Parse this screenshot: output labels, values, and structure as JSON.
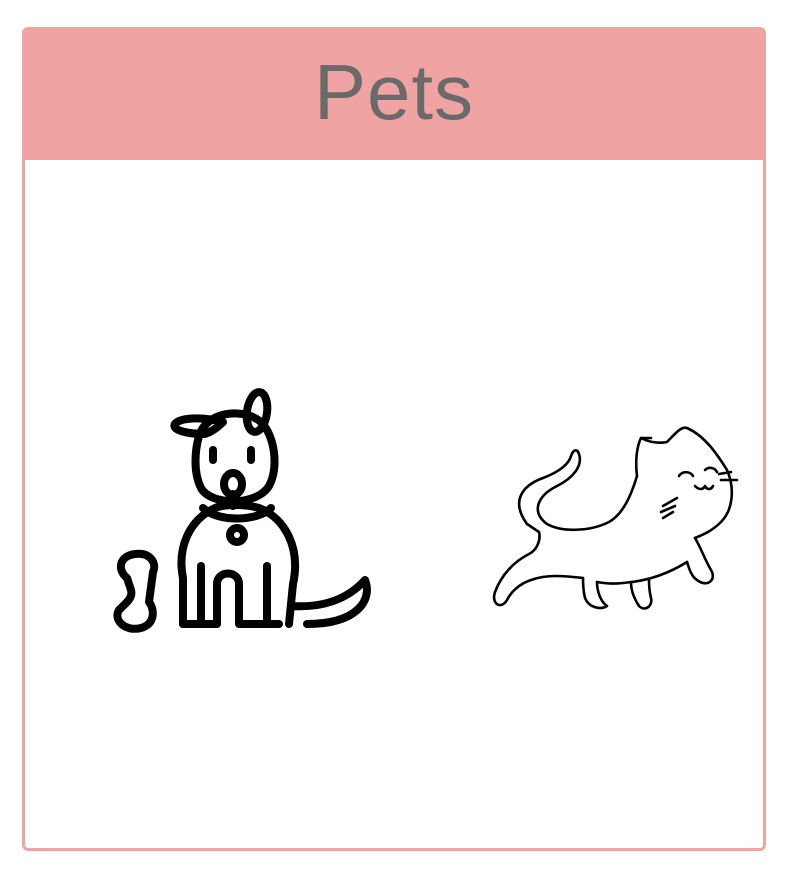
{
  "card": {
    "title": "Pets"
  },
  "illustrations": {
    "dog": "dog-icon",
    "cat": "cat-icon"
  },
  "colors": {
    "header_background": "#f0a3a3",
    "border": "#efa3a3",
    "title_text": "#6a6a6a",
    "line_art": "#000000"
  }
}
